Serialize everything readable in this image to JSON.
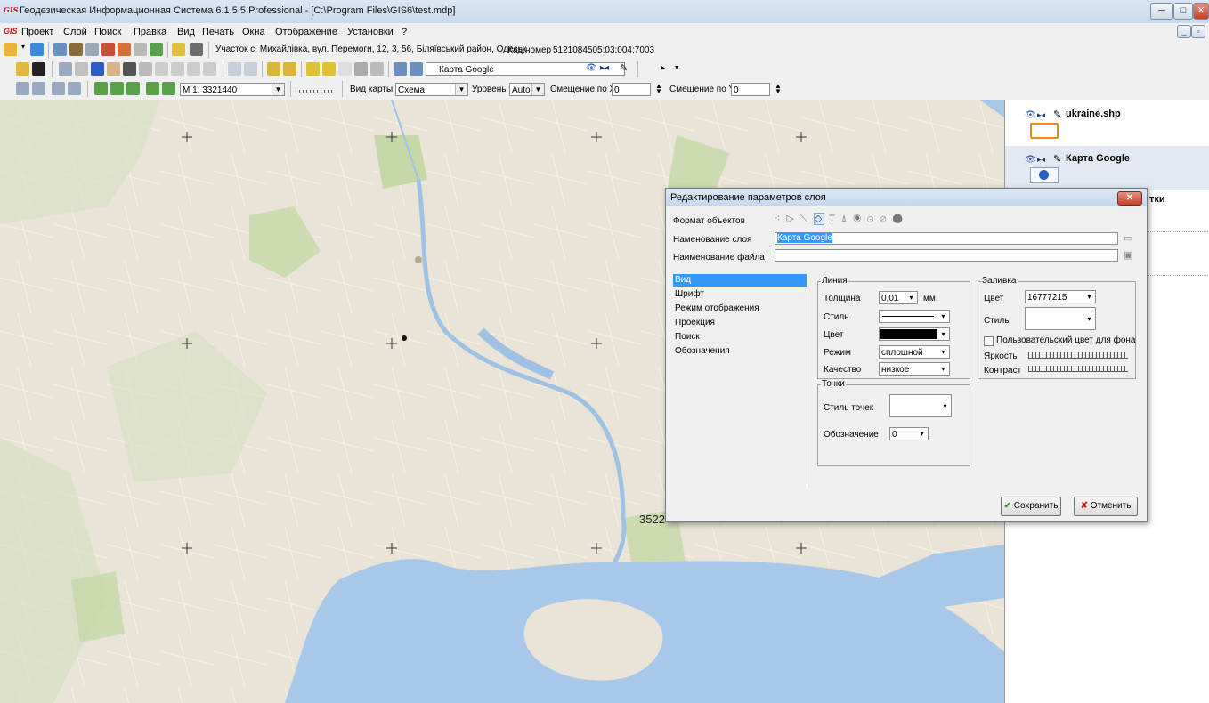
{
  "window": {
    "title": "Геодезическая Информационная Система 6.1.5.5 Professional - [C:\\Program Files\\GIS6\\test.mdp]",
    "app_icon": "GIS",
    "buttons": {
      "minimize": "─",
      "maximize": "□",
      "close": "✕"
    }
  },
  "menu": {
    "icon": "GIS",
    "items": [
      "Проект",
      "Слой",
      "Поиск",
      "Правка",
      "Вид",
      "Печать",
      "Окна",
      "Отображение",
      "Установки",
      "?"
    ]
  },
  "toolbar1": {
    "parcel_text": "Участок  с. Михайлівка, вул. Перемоги, 12, 3, 56, Біляївський район, Одеськ",
    "cadastral_label": "Кад.номер",
    "cadastral_value": "5121084505:03:004:7003"
  },
  "toolbar2": {
    "layer_combo": "Карта Google"
  },
  "toolbar3": {
    "scale_value": "M 1: 3321440",
    "map_view_label": "Вид карты",
    "map_view_value": "Схема",
    "level_label": "Уровень",
    "level_value": "Auto",
    "offset_x_label": "Смещение по X",
    "offset_x_value": "0",
    "offset_y_label": "Смещение по Y",
    "offset_y_value": "0"
  },
  "map": {
    "overlay_number": "3522"
  },
  "layers": [
    {
      "name": "ukraine.shp"
    },
    {
      "name": "Карта Google"
    },
    {
      "name": "тки"
    }
  ],
  "dialog": {
    "title": "Редактирование параметров слоя",
    "close": "✕",
    "format_label": "Формат объектов",
    "layer_name_label": "Наменование слоя",
    "layer_name_value": "Карта Google",
    "file_name_label": "Наименование файла",
    "file_name_value": "",
    "tabs": [
      "Вид",
      "Шрифт",
      "Режим отображения",
      "Проекция",
      "Поиск",
      "Обозначения"
    ],
    "line": {
      "title": "Линия",
      "thickness_label": "Толщина",
      "thickness_value": "0,01",
      "thickness_unit": "мм",
      "style_label": "Стиль",
      "color_label": "Цвет",
      "color_value": "#000000",
      "mode_label": "Режим",
      "mode_value": "сплошной",
      "quality_label": "Качество",
      "quality_value": "низкое"
    },
    "fill": {
      "title": "Заливка",
      "color_label": "Цвет",
      "color_value": "16777215",
      "style_label": "Стиль",
      "custom_bg_label": "Пользовательский цвет для фона",
      "brightness_label": "Яркость",
      "contrast_label": "Контраст"
    },
    "points": {
      "title": "Точки",
      "style_label": "Стиль точек",
      "symbol_label": "Обозначение",
      "symbol_value": "0"
    },
    "save_label": "Сохранить",
    "cancel_label": "Отменить"
  }
}
